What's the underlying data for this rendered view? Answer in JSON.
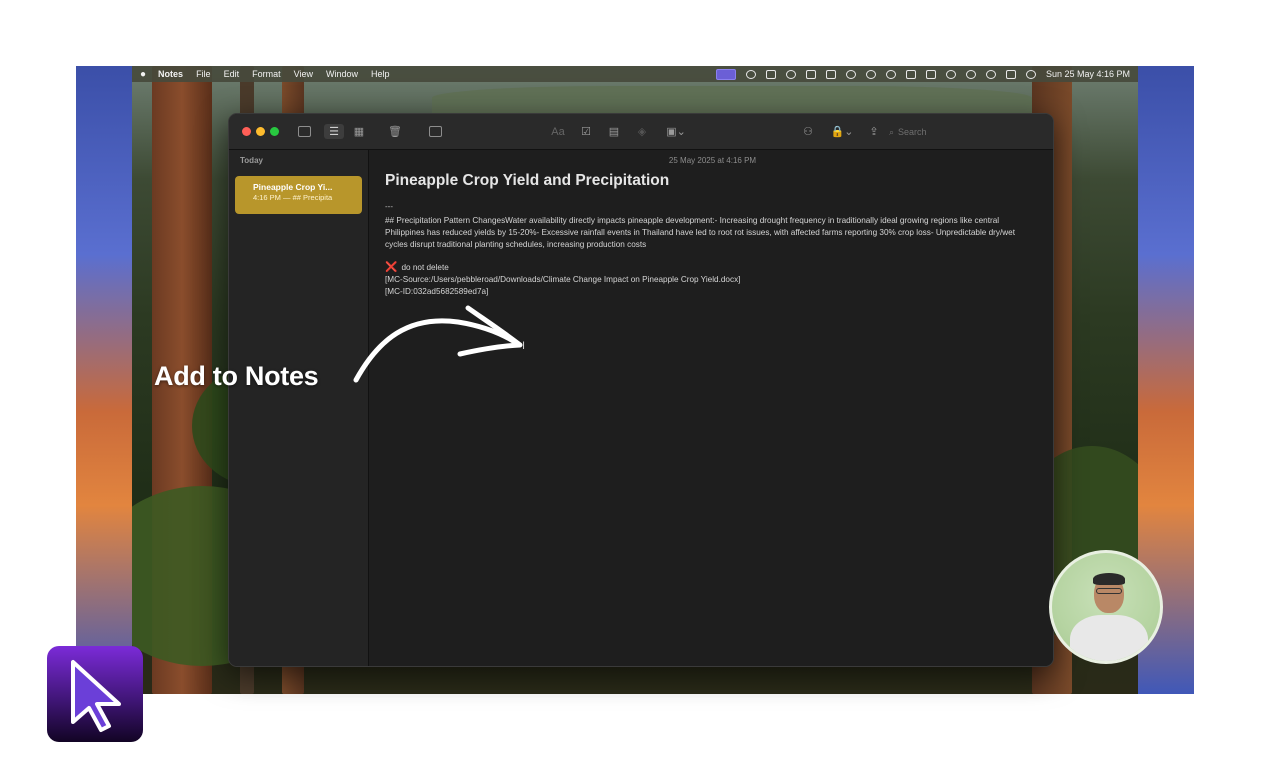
{
  "menubar": {
    "app": "Notes",
    "items": [
      "File",
      "Edit",
      "Format",
      "View",
      "Window",
      "Help"
    ],
    "clock": "Sun 25 May 4:16 PM"
  },
  "toolbar": {
    "font_button": "Aa",
    "search_placeholder": "Search"
  },
  "sidebar": {
    "section": "Today",
    "note": {
      "title": "Pineapple Crop Yi...",
      "time": "4:16 PM",
      "preview": "## Precipita"
    }
  },
  "editor": {
    "date": "25 May 2025 at 4:16 PM",
    "title": "Pineapple Crop Yield and Precipitation",
    "separator": "---",
    "body": "## Precipitation Pattern ChangesWater availability directly impacts pineapple development:- Increasing drought frequency in traditionally ideal growing regions like central Philippines has reduced yields by 15-20%- Excessive rainfall events in Thailand have led to root rot issues, with affected farms reporting 30% crop loss- Unpredictable dry/wet cycles disrupt traditional planting schedules, increasing production costs",
    "flag_icon": "❌",
    "flag_text": "do not delete",
    "source_line": "[MC-Source:/Users/pebbleroad/Downloads/Climate Change Impact on Pineapple Crop Yield.docx]",
    "id_line": "[MC-ID:032ad5682589ed7a]"
  },
  "overlay": {
    "label": "Add to Notes"
  },
  "colors": {
    "note_highlight": "#b8962b",
    "close": "#ff5f57",
    "minimize": "#febc2e",
    "zoom": "#28c840"
  }
}
